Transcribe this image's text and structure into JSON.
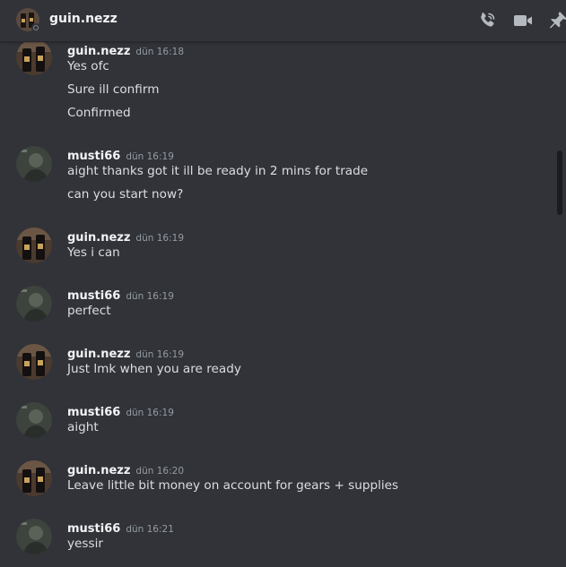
{
  "header": {
    "title": "guin.nezz"
  },
  "messages": [
    {
      "author": "guin.nezz",
      "time": "dün 16:18",
      "lines": [
        "Yes ofc",
        "Sure ill confirm",
        "Confirmed"
      ]
    },
    {
      "author": "musti66",
      "time": "dün 16:19",
      "lines": [
        "aight thanks got it ill be ready in 2 mins for trade",
        "can you start now?"
      ]
    },
    {
      "author": "guin.nezz",
      "time": "dün 16:19",
      "lines": [
        "Yes i can"
      ]
    },
    {
      "author": "musti66",
      "time": "dün 16:19",
      "lines": [
        "perfect"
      ]
    },
    {
      "author": "guin.nezz",
      "time": "dün 16:19",
      "lines": [
        "Just lmk when you are ready"
      ]
    },
    {
      "author": "musti66",
      "time": "dün 16:19",
      "lines": [
        "aight"
      ]
    },
    {
      "author": "guin.nezz",
      "time": "dün 16:20",
      "lines": [
        "Leave little bit money on account for gears + supplies"
      ]
    },
    {
      "author": "musti66",
      "time": "dün 16:21",
      "lines": [
        "yessir"
      ]
    }
  ],
  "colors": {
    "background": "#313338",
    "author_text": "#f2f3f5",
    "message_text": "#dbdee1",
    "timestamp": "#949ba4",
    "icon": "#b5bac1"
  },
  "icons": [
    "voice-call-icon",
    "video-call-icon",
    "pin-icon"
  ]
}
